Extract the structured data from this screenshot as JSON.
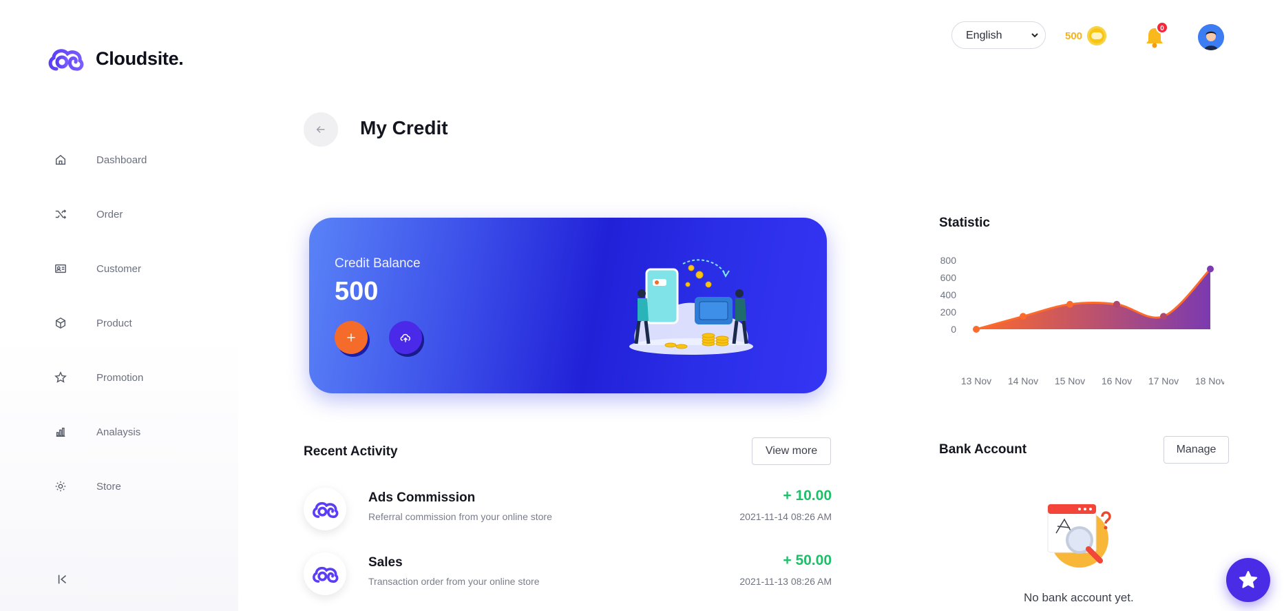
{
  "brand": {
    "name": "Cloudsite."
  },
  "sidebar": {
    "items": [
      {
        "label": "Dashboard",
        "icon": "home-icon"
      },
      {
        "label": "Order",
        "icon": "shuffle-icon"
      },
      {
        "label": "Customer",
        "icon": "id-card-icon"
      },
      {
        "label": "Product",
        "icon": "box-icon"
      },
      {
        "label": "Promotion",
        "icon": "star-icon"
      },
      {
        "label": "Analaysis",
        "icon": "bar-chart-icon"
      },
      {
        "label": "Store",
        "icon": "gear-icon"
      }
    ]
  },
  "topbar": {
    "language": "English",
    "credits": "500",
    "notifications": "0"
  },
  "page": {
    "title": "My Credit"
  },
  "credit_card": {
    "label": "Credit Balance",
    "value": "500",
    "colors": {
      "add": "#f56b2a",
      "upload": "#4b29e8"
    }
  },
  "recent_activity": {
    "title": "Recent Activity",
    "view_more": "View more",
    "items": [
      {
        "title": "Ads Commission",
        "desc": "Referral commission from your online store",
        "amount": "+ 10.00",
        "date": "2021-11-14 08:26 AM"
      },
      {
        "title": "Sales",
        "desc": "Transaction order from your online store",
        "amount": "+ 50.00",
        "date": "2021-11-13 08:26 AM"
      }
    ]
  },
  "statistic": {
    "title": "Statistic"
  },
  "chart_data": {
    "type": "area",
    "title": "Statistic",
    "categories": [
      "13 Nov",
      "14 Nov",
      "15 Nov",
      "16 Nov",
      "17 Nov",
      "18 Nov"
    ],
    "values": [
      0,
      150,
      290,
      290,
      150,
      700
    ],
    "yticks": [
      "0",
      "200",
      "400",
      "600",
      "800"
    ],
    "ylim": [
      0,
      800
    ],
    "grid": false,
    "colors": {
      "start": "#fc6a2c",
      "end": "#7b3ab0"
    }
  },
  "bank_account": {
    "title": "Bank Account",
    "manage": "Manage",
    "empty": "No bank account yet."
  }
}
